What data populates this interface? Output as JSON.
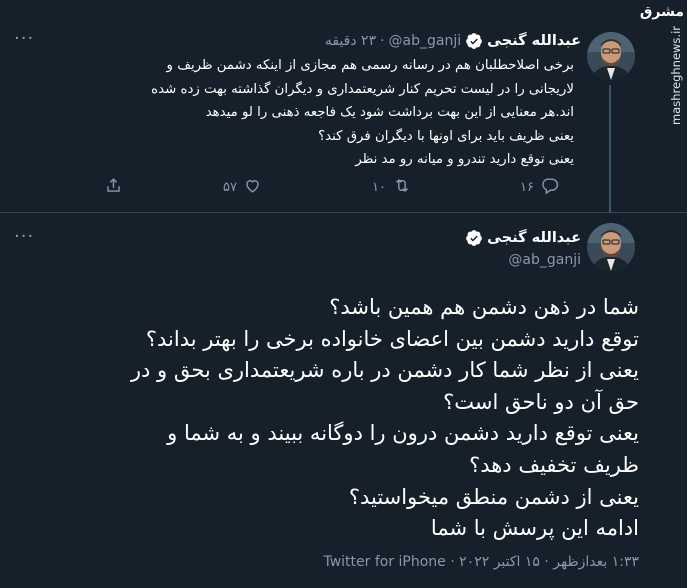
{
  "watermark": {
    "logo": "مشرق",
    "site": "mashreghnews.ir"
  },
  "reply_tweet": {
    "display_name": "عبدالله گنجی",
    "handle": "@ab_ganji",
    "time_ago": "۲۳ دقیقه",
    "more_label": "···",
    "lines": [
      "برخی اصلاحطلبان هم در رسانه رسمی هم مجازی از اینکه دشمن ظریف و",
      "لاریجانی را در لیست تحریم کنار شریعتمداری و دیگران گذاشته بهت زده شده",
      "اند.هر معنایی از این بهت برداشت شود یک فاجعه ذهنی را لو میدهد",
      "یعنی ظریف باید برای اونها با دیگران فرق کند؟",
      "یعنی توقع دارید تندرو و میانه رو مد نظر"
    ],
    "actions": {
      "reply_count": "۱۶",
      "retweet_count": "۱۰",
      "like_count": "۵۷"
    }
  },
  "main_tweet": {
    "display_name": "عبدالله گنجی",
    "handle": "@ab_ganji",
    "more_label": "···",
    "lines": [
      "شما در ذهن دشمن هم همین باشد؟",
      "توقع دارید دشمن بین اعضای خانواده برخی را بهتر بداند؟",
      "یعنی از نظر شما کار دشمن در باره شریعتمداری بحق و در",
      "حق آن دو ناحق است؟",
      "یعنی توقع دارید دشمن درون را دوگانه ببیند و به شما و",
      "ظریف تخفیف دهد؟",
      "یعنی از دشمن منطق میخواستید؟",
      "ادامه این پرسش با شما"
    ],
    "time": "۱:۳۳ بعدازظهر",
    "date": "۱۵ اکتبر ۲۰۲۲",
    "source": "Twitter for iPhone",
    "separator": "·"
  },
  "colors": {
    "background": "#15202b",
    "divider": "#38444d",
    "muted": "#8899a6",
    "text": "#ffffff",
    "verified": "#ffffff"
  },
  "icons": [
    "verified-badge-icon",
    "reply-icon",
    "retweet-icon",
    "like-icon",
    "share-icon",
    "more-icon"
  ]
}
